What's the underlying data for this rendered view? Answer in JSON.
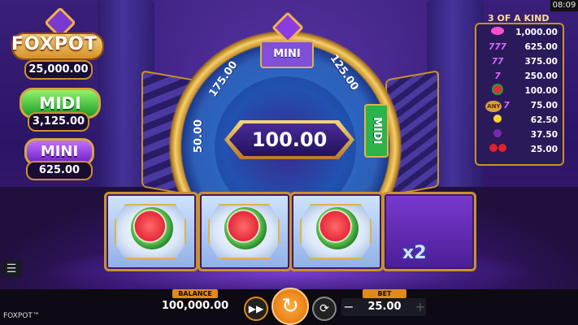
{
  "status": {
    "clock": "08:09"
  },
  "jackpots": {
    "logo": "FOXPOT",
    "foxpot_amount": "25,000.00",
    "midi_label": "MIDI",
    "midi_amount": "3,125.00",
    "mini_label": "MINI",
    "mini_amount": "625.00"
  },
  "wheel": {
    "center_value": "100.00",
    "segments": {
      "top": "MINI",
      "right": "MIDI",
      "upper_left": "175.00",
      "upper_right": "125.00",
      "left": "50.00"
    }
  },
  "reels": [
    {
      "symbol": "watermelon"
    },
    {
      "symbol": "watermelon"
    },
    {
      "symbol": "watermelon"
    },
    {
      "symbol": "multiplier",
      "text": "x2"
    }
  ],
  "paytable": {
    "title": "3 OF A KIND",
    "rows": [
      {
        "symbol": "wild",
        "value": "1,000.00"
      },
      {
        "symbol": "777",
        "value": "625.00"
      },
      {
        "symbol": "77",
        "value": "375.00"
      },
      {
        "symbol": "7",
        "value": "250.00"
      },
      {
        "symbol": "watermelon",
        "value": "100.00"
      },
      {
        "symbol": "any-7",
        "any_label": "ANY",
        "seven": "7",
        "value": "75.00"
      },
      {
        "symbol": "lemon",
        "value": "62.50"
      },
      {
        "symbol": "plum",
        "value": "37.50"
      },
      {
        "symbol": "cherries",
        "value": "25.00"
      }
    ],
    "seven_labels": {
      "triple": "777",
      "double": "77",
      "single": "7"
    }
  },
  "bottom_bar": {
    "brand": "FOXPOT™",
    "balance_label": "BALANCE",
    "balance_value": "100,000.00",
    "bet_label": "BET",
    "bet_value": "25.00",
    "bet_minus": "−",
    "bet_plus": "+"
  },
  "colors": {
    "accent_gold": "#c9922f",
    "spin_orange": "#e06a0a",
    "midi_green": "#1e9a2a",
    "mini_purple": "#6d1fc0"
  }
}
